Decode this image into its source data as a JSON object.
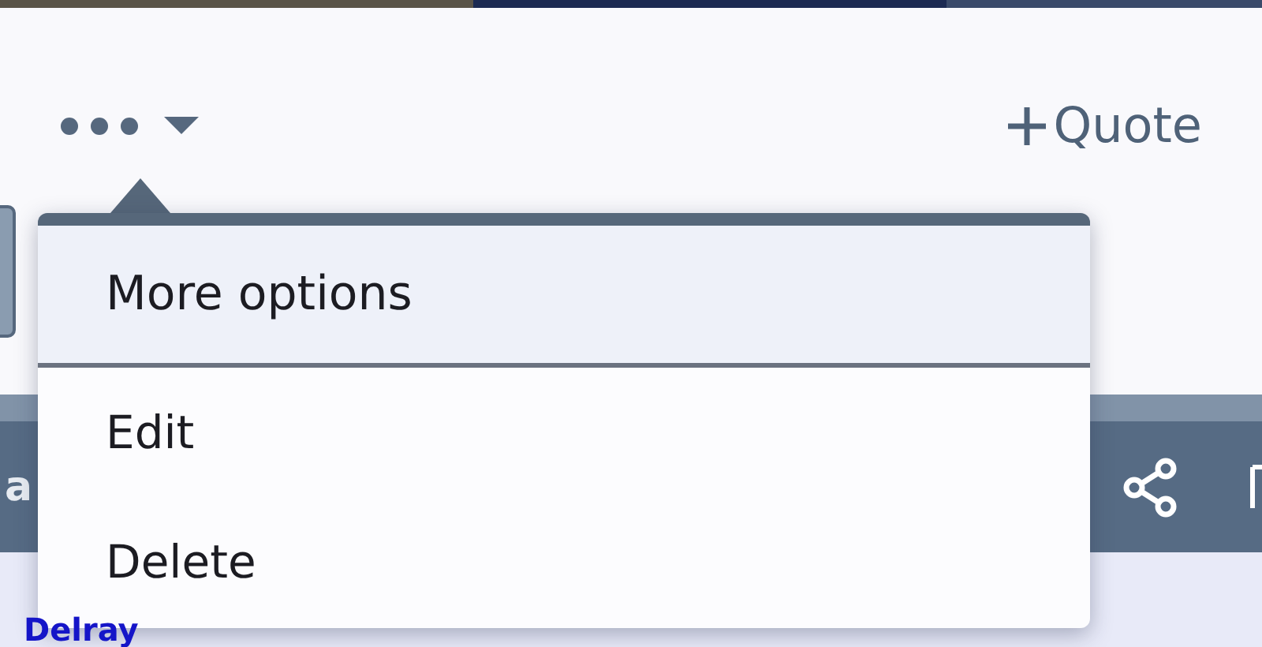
{
  "toolbar": {
    "more_button": {
      "expanded": true
    },
    "quote_link": {
      "label": "Quote"
    }
  },
  "post_bar": {
    "text": "a"
  },
  "link": "Delray",
  "menu": {
    "header": "More options",
    "items": [
      {
        "label": "Edit"
      },
      {
        "label": "Delete"
      }
    ]
  }
}
